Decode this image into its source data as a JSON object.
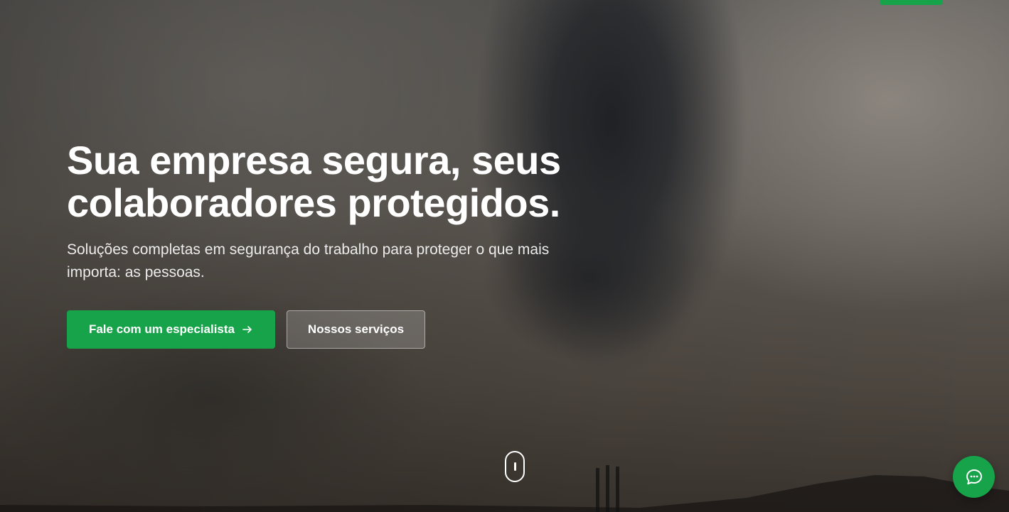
{
  "hero": {
    "title_line1": "Sua empresa segura, seus",
    "title_line2": "colaboradores protegidos.",
    "subtitle": "Soluções completas em segurança do trabalho para proteger o que mais importa: as pessoas.",
    "primary_button_label": "Fale com um especialista",
    "primary_button_icon": "arrow-right-icon",
    "secondary_button_label": "Nossos serviços"
  },
  "scroll_indicator": {
    "icon": "mouse-scroll-icon"
  },
  "chat": {
    "icon": "chat-bubble-icon"
  },
  "colors": {
    "accent": "#16a34a",
    "text": "#ffffff"
  }
}
